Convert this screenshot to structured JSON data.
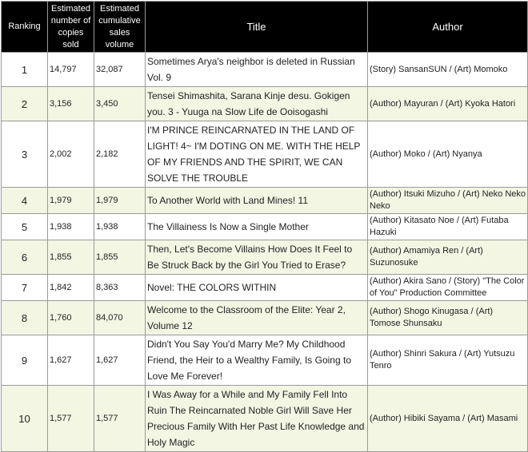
{
  "headers": {
    "ranking": "Ranking",
    "copies_sold": "Estimated number of copies sold",
    "cumulative": "Estimated cumulative sales volume",
    "title": "Title",
    "author": "Author"
  },
  "rows": [
    {
      "rank": "1",
      "copies": "14,797",
      "cumulative": "32,087",
      "title": "Sometimes Arya's neighbor is deleted in Russian Vol. 9",
      "author": "(Story) SansanSUN / (Art) Momoko"
    },
    {
      "rank": "2",
      "copies": "3,156",
      "cumulative": "3,450",
      "title": "Tensei Shimashita, Sarana Kinje desu. Gokigen you. 3 - Yuuga na Slow Life de Ooisogashi",
      "author": "(Author) Mayuran / (Art) Kyoka Hatori"
    },
    {
      "rank": "3",
      "copies": "2,002",
      "cumulative": "2,182",
      "title": " I'M PRINCE REINCARNATED IN THE LAND OF LIGHT!  4~ I'M DOTING ON ME. WITH THE HELP OF MY FRIENDS AND THE SPIRIT, WE CAN SOLVE THE TROUBLE",
      "author": "(Author) Moko / (Art) Nyanya"
    },
    {
      "rank": "4",
      "copies": "1,979",
      "cumulative": "1,979",
      "title": "To Another World with Land Mines! 11",
      "author": "(Author) Itsuki Mizuho / (Art) Neko Neko Neko"
    },
    {
      "rank": "5",
      "copies": "1,938",
      "cumulative": "1,938",
      "title": "The Villainess Is Now a Single Mother",
      "author": "(Author) Kitasato Noe / (Art) Futaba Hazuki"
    },
    {
      "rank": "6",
      "copies": "1,855",
      "cumulative": "1,855",
      "title": "Then, Let's Become Villains How Does It Feel to Be Struck Back by the Girl You Tried to Erase?",
      "author": "(Author) Amamiya Ren / (Art) Suzunosuke"
    },
    {
      "rank": "7",
      "copies": "1,842",
      "cumulative": "8,363",
      "title": "Novel: THE COLORS WITHIN",
      "author": "(Author) Akira Sano / (Story) \"The Color of You\" Production Committee"
    },
    {
      "rank": "8",
      "copies": "1,760",
      "cumulative": "84,070",
      "title": "Welcome to the Classroom of the Elite: Year 2, Volume 12",
      "author": "(Author) Shogo Kinugasa / (Art) Tomose Shunsaku"
    },
    {
      "rank": "9",
      "copies": "1,627",
      "cumulative": "1,627",
      "title": "Didn't You Say You'd Marry Me? My Childhood Friend, the Heir to a Wealthy Family, Is Going to Love Me Forever!",
      "author": "(Author) Shinri Sakura / (Art) Yutsuzu Tenro"
    },
    {
      "rank": "10",
      "copies": "1,577",
      "cumulative": "1,577",
      "title": "I Was Away for a While and My Family Fell Into Ruin The Reincarnated Noble Girl Will Save Her Precious Family With Her Past Life Knowledge and Holy Magic",
      "author": "(Author) Hibiki Sayama / (Art) Masami"
    }
  ]
}
